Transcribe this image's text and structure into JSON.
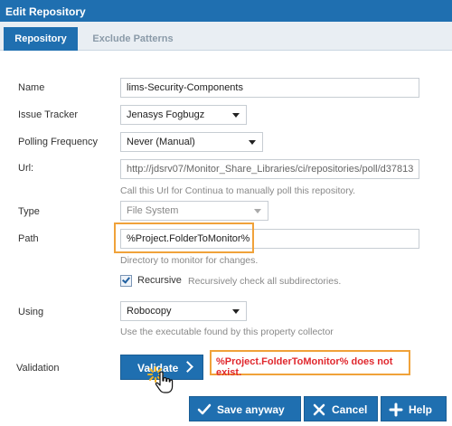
{
  "window": {
    "title": "Edit Repository"
  },
  "tabs": [
    {
      "label": "Repository",
      "active": true
    },
    {
      "label": "Exclude Patterns",
      "active": false
    }
  ],
  "form": {
    "name": {
      "label": "Name",
      "value": "lims-Security-Components"
    },
    "issue_tracker": {
      "label": "Issue Tracker",
      "value": "Jenasys Fogbugz"
    },
    "polling_frequency": {
      "label": "Polling Frequency",
      "value": "Never (Manual)"
    },
    "url": {
      "label": "Url:",
      "value": "http://jdsrv07/Monitor_Share_Libraries/ci/repositories/poll/d37813",
      "hint": "Call this Url for Continua to manually poll this repository."
    },
    "type": {
      "label": "Type",
      "value": "File System"
    },
    "path": {
      "label": "Path",
      "value": "%Project.FolderToMonitor%",
      "hint": "Directory to monitor for changes."
    },
    "recursive": {
      "label": "Recursive",
      "checked": true,
      "hint": "Recursively check all subdirectories."
    },
    "using": {
      "label": "Using",
      "value": "Robocopy",
      "hint": "Use the executable found by this property collector"
    },
    "validation": {
      "label": "Validation",
      "button_label": "Validate",
      "error": "%Project.FolderToMonitor% does not exist."
    }
  },
  "footer": {
    "save_label": "Save anyway",
    "cancel_label": "Cancel",
    "help_label": "Help"
  },
  "colors": {
    "primary": "#1f6fb0",
    "highlight": "#f0a23a",
    "error": "#e0282e"
  }
}
